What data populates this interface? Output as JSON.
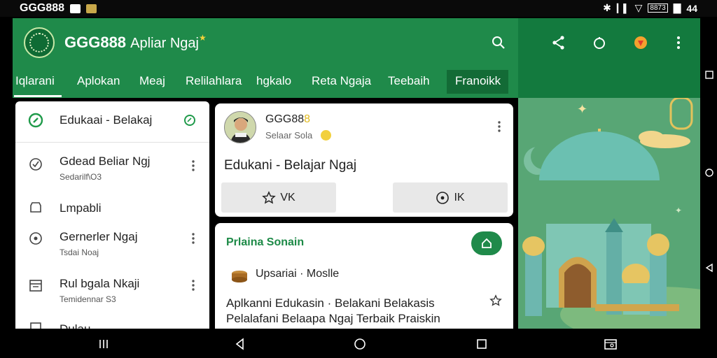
{
  "status_bar": {
    "left_text": "GGG888",
    "battery_text": "8873",
    "right_text": "44"
  },
  "app": {
    "title": "GGG888",
    "subtitle": "Apliar Ngaj",
    "tabs": [
      {
        "label": "Iqlarani"
      },
      {
        "label": "Aplokan"
      },
      {
        "label": "Meaj"
      },
      {
        "label": "Relilahlara"
      },
      {
        "label": "hgkalo"
      },
      {
        "label": "Reta Ngaja"
      },
      {
        "label": "Teebaih"
      },
      {
        "label": "Franoikk"
      }
    ]
  },
  "list": {
    "items": [
      {
        "title": "Edukaai - Belakaj",
        "subtitle": "",
        "icon": "compass-icon"
      },
      {
        "title": "Gdead Beliar Ngj",
        "subtitle": "Sedarilf\\O3",
        "icon": "check-circle-icon"
      },
      {
        "title": "Lmpabli",
        "subtitle": "",
        "icon": "clock-icon"
      },
      {
        "title": "Gernerler Ngaj",
        "subtitle": "Tsdai Noaj",
        "icon": "circle-icon"
      },
      {
        "title": "Rul bgala Nkaji",
        "subtitle": "Temidennar S3",
        "icon": "calendar-icon"
      },
      {
        "title": "Dulau",
        "subtitle": "",
        "icon": "book-icon"
      }
    ]
  },
  "card_profile": {
    "name": "GGG88",
    "name_accent": "8",
    "sub": "Selaar Sola",
    "title": "Edukani - Belajar Ngaj",
    "buttons": [
      {
        "label": "VK",
        "icon": "star-icon"
      },
      {
        "label": "IK",
        "icon": "target-icon"
      }
    ]
  },
  "card_info": {
    "title": "Prlaina Sonain",
    "row_text": "Upsariai · Moslle",
    "body": "Aplkanni Edukasin · Belakani Belakasis Pelalafani Belaapa Ngaj Terbaik Praiskin Baraiksta Ngajin Terbaik"
  },
  "colors": {
    "primary": "#1f8a4a",
    "primary_dark": "#137a3e",
    "art_bg": "#57a473",
    "accent": "#f2d03d"
  }
}
